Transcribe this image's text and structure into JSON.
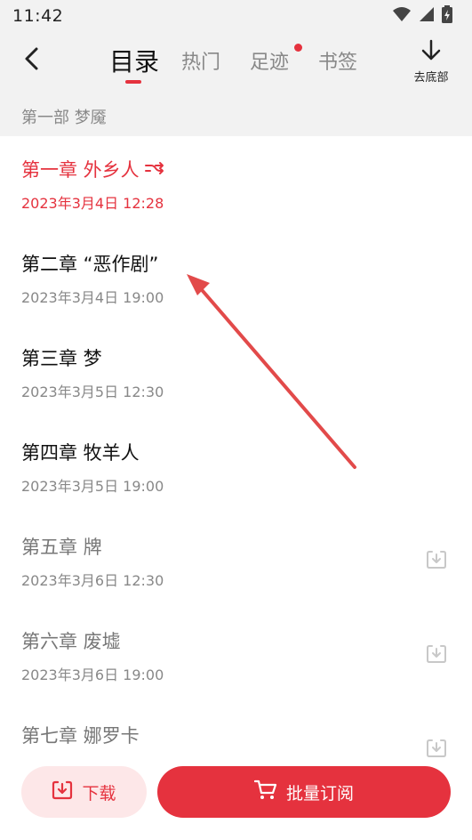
{
  "status_bar": {
    "time": "11:42"
  },
  "header": {
    "tabs": [
      {
        "label": "目录",
        "active": true
      },
      {
        "label": "热门",
        "active": false
      },
      {
        "label": "足迹",
        "active": false,
        "has_dot": true
      },
      {
        "label": "书签",
        "active": false
      }
    ],
    "to_bottom_label": "去底部"
  },
  "section": {
    "title": "第一部 梦魇"
  },
  "chapters": [
    {
      "title": "第一章 外乡人",
      "date": "2023年3月4日 12:28",
      "state": "current"
    },
    {
      "title": "第二章 “恶作剧”",
      "date": "2023年3月4日 19:00",
      "state": "free"
    },
    {
      "title": "第三章 梦",
      "date": "2023年3月5日 12:30",
      "state": "free"
    },
    {
      "title": "第四章 牧羊人",
      "date": "2023年3月5日 19:00",
      "state": "free"
    },
    {
      "title": "第五章 牌",
      "date": "2023年3月6日 12:30",
      "state": "locked"
    },
    {
      "title": "第六章 废墟",
      "date": "2023年3月6日 19:00",
      "state": "locked"
    },
    {
      "title": "第七章 娜罗卡",
      "date": "",
      "state": "locked"
    }
  ],
  "bottom": {
    "download_label": "下载",
    "subscribe_label": "批量订阅"
  },
  "colors": {
    "accent": "#e5323e",
    "accent_light": "#fde7e8",
    "header_bg": "#f2f2f2"
  }
}
